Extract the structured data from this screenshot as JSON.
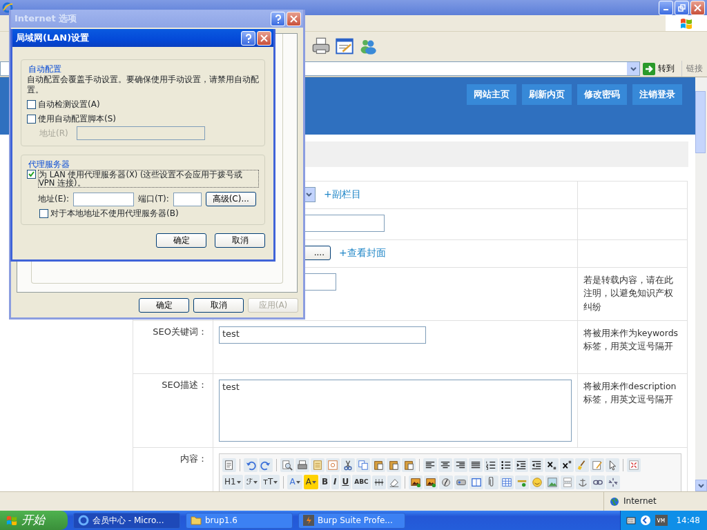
{
  "address_bar": {
    "go_button": "转到",
    "links": "链接"
  },
  "header": {
    "buttons": [
      "网站主页",
      "刷新内页",
      "修改密码",
      "注销登录"
    ]
  },
  "form": {
    "rows": [
      {
        "kind": "select",
        "link": "+副栏目"
      },
      {
        "kind": "input"
      },
      {
        "kind": "button",
        "button": "....",
        "link": "+查看封面"
      },
      {
        "kind": "input",
        "note": "若是转载内容，请在此注明，以避免知识产权纠纷"
      },
      {
        "kind": "input",
        "label": "SEO关键词：",
        "value": "test",
        "note": "将被用来作为keywords标签，用英文逗号隔开"
      },
      {
        "kind": "textarea",
        "label": "SEO描述：",
        "value": "test",
        "note": "将被用来作description标签，用英文逗号隔开"
      },
      {
        "kind": "editor",
        "label": "内容："
      }
    ]
  },
  "editor_toolbar": {
    "text_buttons": [
      {
        "label": "H1",
        "caret": true
      },
      {
        "label": "ℱ",
        "caret": true
      },
      {
        "label": "тT",
        "caret": true
      },
      {
        "label": "A",
        "caret": true,
        "color": "#3a6fd8"
      },
      {
        "label": "A",
        "caret": true,
        "color": "#ffd200"
      },
      {
        "label": "B",
        "caret": false
      },
      {
        "label": "I",
        "caret": false
      },
      {
        "label": "U",
        "caret": false
      },
      {
        "label": "ABC",
        "caret": false
      }
    ]
  },
  "status_bar": {
    "zone": "Internet"
  },
  "internet_options": {
    "title": "Internet 选项",
    "buttons": [
      {
        "label": "确定",
        "disabled": false
      },
      {
        "label": "取消",
        "disabled": false
      },
      {
        "label": "应用(A)",
        "disabled": true
      }
    ]
  },
  "lan_dialog": {
    "title": "局域网(LAN)设置",
    "auto_group": {
      "title": "自动配置",
      "text": "自动配置会覆盖手动设置。要确保使用手动设置，请禁用自动配置。",
      "options": [
        {
          "label": "自动检测设置(A)",
          "checked": false
        },
        {
          "label": "使用自动配置脚本(S)",
          "checked": false
        }
      ],
      "address": {
        "label": "地址(R)",
        "disabled": true
      }
    },
    "proxy_group": {
      "title": "代理服务器",
      "use_proxy": {
        "label": "为 LAN 使用代理服务器(X) (这些设置不会应用于拨号或 VPN 连接)。",
        "checked": true
      },
      "address_label": "地址(E):",
      "port_label": "端口(T):",
      "advanced_button": "高级(C)...",
      "bypass": {
        "label": "对于本地地址不使用代理服务器(B)",
        "checked": false
      }
    },
    "buttons": [
      "确定",
      "取消"
    ]
  },
  "taskbar": {
    "start": "开始",
    "tasks": [
      {
        "label": "会员中心 - Micro...",
        "selected": true
      },
      {
        "label": "brup1.6",
        "selected": false
      },
      {
        "label": "Burp Suite Profe...",
        "selected": false
      }
    ],
    "clock": "14:48"
  }
}
